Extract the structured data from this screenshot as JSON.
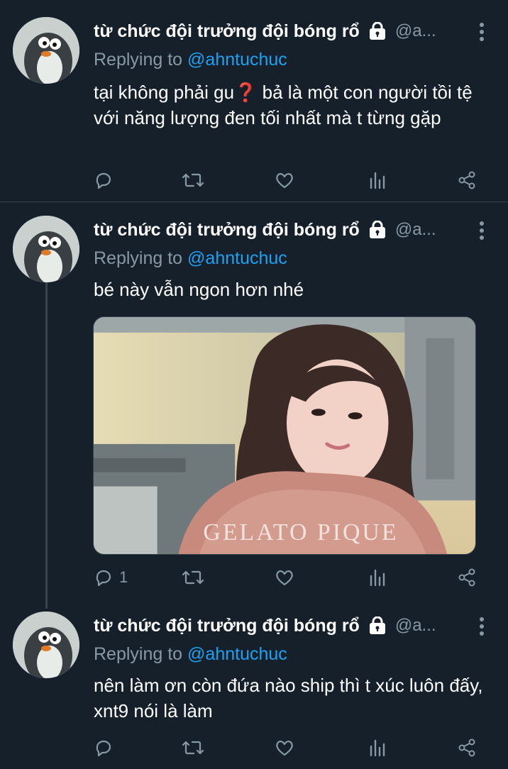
{
  "author": {
    "name": "từ chức đội trưởng đội bóng rổ",
    "handle": "@a...",
    "protected_icon": "lock-icon",
    "avatar_icon": "penguin-avatar"
  },
  "replying_prefix": "Replying to",
  "reply_target": "@ahntuchuc",
  "tweets": [
    {
      "text": "tại không phải gu❓ bả là một con người tồi tệ với năng lượng đen tối nhất mà t từng gặp",
      "reply_count": ""
    },
    {
      "text": "bé này vẫn ngon hơn nhé",
      "reply_count": "1",
      "media": {
        "type": "photo",
        "shirt_text": "GELATO PIQUE"
      }
    },
    {
      "text": "nên làm ơn còn đứa nào ship thì t xúc luôn đấy, xnt9 nói là làm",
      "reply_count": ""
    }
  ],
  "action_icons": [
    "reply-icon",
    "retweet-icon",
    "like-icon",
    "analytics-icon",
    "share-icon"
  ],
  "colors": {
    "background": "#15202b",
    "text_primary": "#ffffff",
    "text_secondary": "#8899a6",
    "accent": "#1da1f2",
    "divider": "#38444d"
  }
}
